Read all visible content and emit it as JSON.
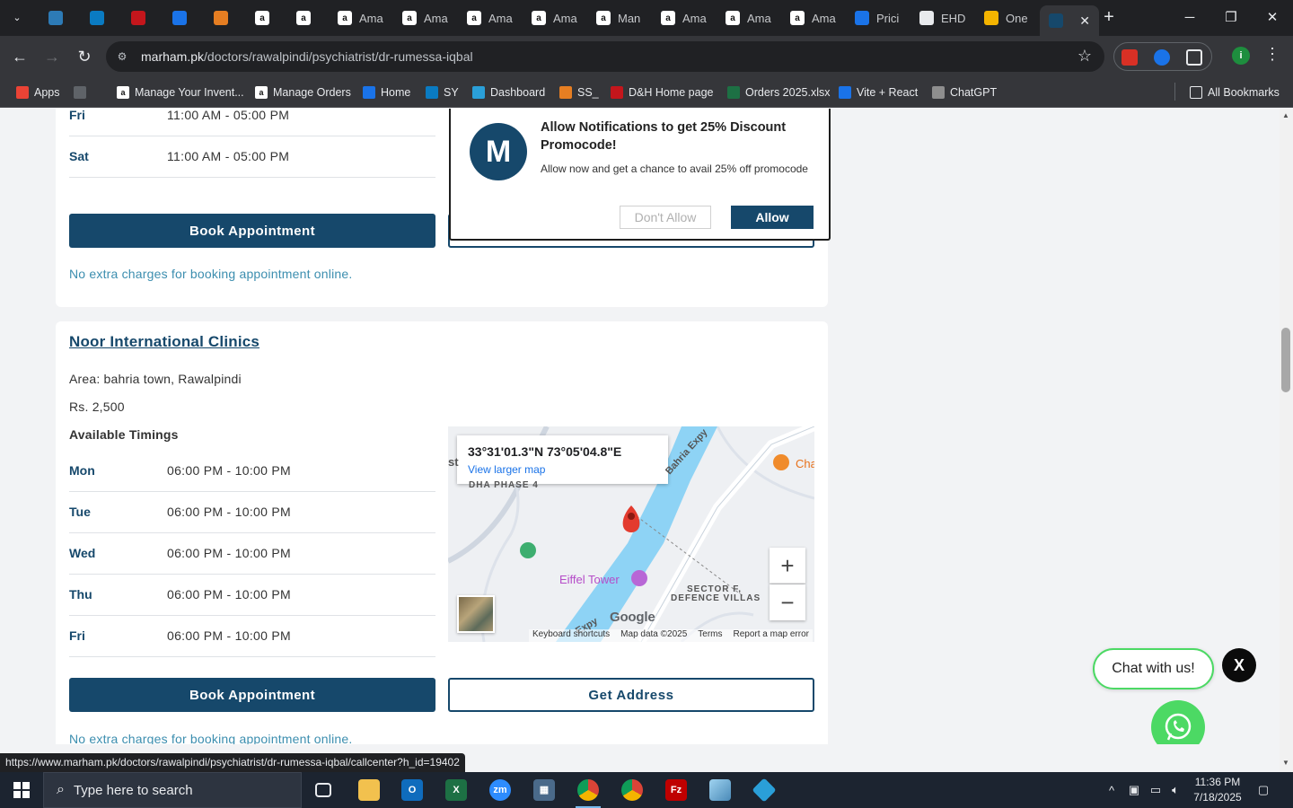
{
  "browser": {
    "tabs": [
      {
        "label": "",
        "icon": "tab-icon-1",
        "color": "#2d7bb6"
      },
      {
        "label": "",
        "icon": "ec-icon",
        "color": "#0a7bc2"
      },
      {
        "label": "",
        "icon": "dh-icon",
        "color": "#c4161c"
      },
      {
        "label": "",
        "icon": "g-icon",
        "color": "#1a73e8"
      },
      {
        "label": "",
        "icon": "box-icon",
        "color": "#e67e22"
      },
      {
        "label": "",
        "icon": "amazon-icon",
        "color": "#ffffff"
      },
      {
        "label": "",
        "icon": "amazon-icon",
        "color": "#ffffff"
      },
      {
        "label": "Ama",
        "icon": "amazon-icon",
        "color": "#ffffff"
      },
      {
        "label": "Ama",
        "icon": "amazon-icon",
        "color": "#ffffff"
      },
      {
        "label": "Ama",
        "icon": "amazon-icon",
        "color": "#ffffff"
      },
      {
        "label": "Ama",
        "icon": "amazon-icon",
        "color": "#ffffff"
      },
      {
        "label": "Man",
        "icon": "amazon-icon",
        "color": "#ffffff"
      },
      {
        "label": "Ama",
        "icon": "amazon-icon",
        "color": "#ffffff"
      },
      {
        "label": "Ama",
        "icon": "amazon-icon",
        "color": "#ffffff"
      },
      {
        "label": "Ama",
        "icon": "amazon-icon",
        "color": "#ffffff"
      },
      {
        "label": "Prici",
        "icon": "dollar-icon",
        "color": "#1a73e8"
      },
      {
        "label": "EHD",
        "icon": "openai-icon",
        "color": "#e8eaed"
      },
      {
        "label": "One",
        "icon": "hexagon-icon",
        "color": "#f4b400"
      },
      {
        "label": "",
        "icon": "marham-icon",
        "color": "#16486b",
        "active": true
      }
    ],
    "url_host": "marham.pk",
    "url_path": "/doctors/rawalpindi/psychiatrist/dr-rumessa-iqbal",
    "bookmarks": [
      {
        "label": "Apps",
        "icon": "apps-grid-icon"
      },
      {
        "label": "",
        "icon": "grid-icon"
      },
      {
        "label": "Manage Your Invent...",
        "icon": "amazon-icon"
      },
      {
        "label": "Manage Orders",
        "icon": "amazon-icon"
      },
      {
        "label": "Home",
        "icon": "g-icon"
      },
      {
        "label": "SY",
        "icon": "ec-icon"
      },
      {
        "label": "Dashboard",
        "icon": "diamond-icon"
      },
      {
        "label": "SS_",
        "icon": "box-icon"
      },
      {
        "label": "D&H Home page",
        "icon": "dh-icon"
      },
      {
        "label": "Orders 2025.xlsx",
        "icon": "excel-icon"
      },
      {
        "label": "Vite + React",
        "icon": "dollar-icon"
      },
      {
        "label": "ChatGPT",
        "icon": "openai-icon"
      }
    ],
    "all_bookmarks": "All Bookmarks",
    "profile_initial": "i",
    "status_url": "https://www.marham.pk/doctors/rawalpindi/psychiatrist/dr-rumessa-iqbal/callcenter?h_id=19402"
  },
  "clinic1": {
    "timings": [
      {
        "day": "Fri",
        "time": "11:00 AM - 05:00 PM"
      },
      {
        "day": "Sat",
        "time": "11:00 AM - 05:00 PM"
      }
    ],
    "book_label": "Book Appointment",
    "note": "No extra charges for booking appointment online."
  },
  "clinic2": {
    "name": "Noor International Clinics",
    "area": "Area: bahria town, Rawalpindi",
    "fee": "Rs. 2,500",
    "available_label": "Available Timings",
    "timings": [
      {
        "day": "Mon",
        "time": "06:00 PM - 10:00 PM"
      },
      {
        "day": "Tue",
        "time": "06:00 PM - 10:00 PM"
      },
      {
        "day": "Wed",
        "time": "06:00 PM - 10:00 PM"
      },
      {
        "day": "Thu",
        "time": "06:00 PM - 10:00 PM"
      },
      {
        "day": "Fri",
        "time": "06:00 PM - 10:00 PM"
      }
    ],
    "book_label": "Book Appointment",
    "address_label": "Get Address",
    "note": "No extra charges for booking appointment online.",
    "map": {
      "coords": "33°31'01.3\"N 73°05'04.8\"E",
      "view_larger": "View larger map",
      "labels": {
        "dha": "DHA PHASE 4",
        "expy": "Bahria Expy",
        "expy2": "Expy",
        "eiffel": "Eiffel Tower",
        "sector1": "SECTOR F,",
        "sector2": "DEFENCE VILLAS",
        "cha": "Cha",
        "st": "st"
      },
      "google": "Google",
      "footer": [
        "Keyboard shortcuts",
        "Map data ©2025",
        "Terms",
        "Report a map error"
      ]
    }
  },
  "notification": {
    "logo_letter": "M",
    "title": "Allow Notifications to get 25% Discount Promocode!",
    "message": "Allow now and get a chance to avail 25% off promocode",
    "deny_label": "Don't Allow",
    "allow_label": "Allow"
  },
  "chat": {
    "bubble_label": "Chat with us!",
    "close_label": "X"
  },
  "taskbar": {
    "search_placeholder": "Type here to search",
    "time": "11:36 PM",
    "date": "7/18/2025"
  }
}
